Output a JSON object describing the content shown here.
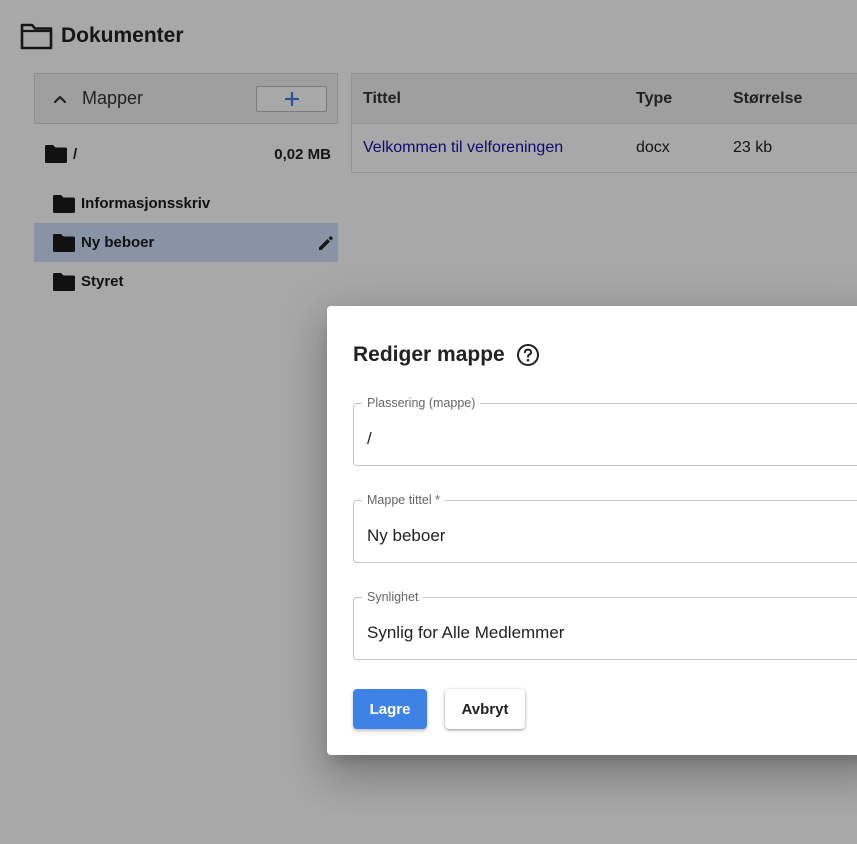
{
  "header": {
    "title": "Dokumenter",
    "icon": "folder-outline-icon"
  },
  "sidebar": {
    "heading": "Mapper",
    "collapse_icon": "chevron-up-icon",
    "add_icon": "plus-icon",
    "root": {
      "name": "/",
      "size": "0,02 MB"
    },
    "folders": [
      {
        "name": "Informasjonsskriv"
      },
      {
        "name": "Ny beboer",
        "selected": true
      },
      {
        "name": "Styret"
      }
    ]
  },
  "table": {
    "columns": [
      "Tittel",
      "Type",
      "Størrelse"
    ],
    "rows": [
      {
        "title": "Velkommen til velforeningen",
        "type": "docx",
        "size": "23 kb"
      }
    ]
  },
  "dialog": {
    "title": "Rediger mappe",
    "help_icon": "help-circle-icon",
    "fields": {
      "location": {
        "label": "Plassering (mappe)",
        "value": "/"
      },
      "folder_title": {
        "label": "Mappe tittel *",
        "value": "Ny beboer"
      },
      "visibility": {
        "label": "Synlighet",
        "value": "Synlig for Alle Medlemmer"
      }
    },
    "save_label": "Lagre",
    "cancel_label": "Avbryt"
  },
  "colors": {
    "primary": "#3f82e6",
    "link": "#1a0dab",
    "selected_row": "#cfe0fb",
    "overlay": "rgba(0,0,0,0.34)"
  }
}
